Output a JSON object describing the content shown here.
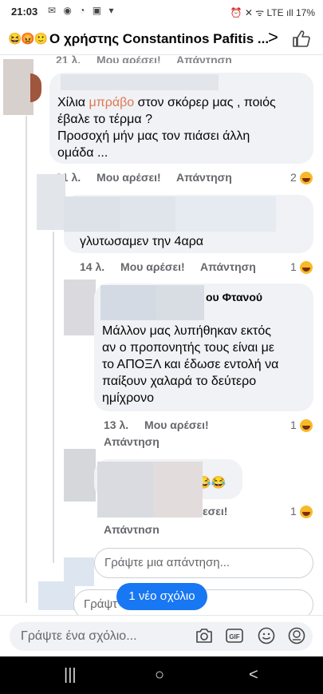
{
  "status_bar": {
    "time": "21:03",
    "left_icons": "✉ ◉ ◔ ▣ ▾",
    "right_text": "⏰ ✕ ᯤ LTE ıll 17%"
  },
  "header": {
    "reactions": "😆😡🙂",
    "title": "Ο χρήστης Constantinos Pafitis ...",
    "back_label": ">"
  },
  "top_partial_meta": {
    "time": "21 λ.",
    "like": "Μου αρέσει!",
    "reply": "Απάντηση"
  },
  "comment_1": {
    "line1_pre": "Χίλια ",
    "line1_highlight": "μπράβο",
    "line1_post": " στον σκόρερ μας , ποιός",
    "line2": "έβαλε το τέρμα ?",
    "line3": "Προσοχή μήν μας τον πιάσει άλλη",
    "line4": "ομάδα ...",
    "time": "21 λ.",
    "like": "Μου αρέσει!",
    "reply": "Απάντηση",
    "reaction_count": "2",
    "highlight_color": "#e0774e"
  },
  "comment_2": {
    "text": "γλυτωσαμεν την 4αρα",
    "time": "14 λ.",
    "like": "Μου αρέσει!",
    "reply": "Απάντηση",
    "reaction_count": "1"
  },
  "comment_3": {
    "author_suffix": "ου Φτανού",
    "line1": "Μάλλον μας λυπήθηκαν εκτός",
    "line2": "αν ο προπονητής τους είναι με",
    "line3": "το ΑΠΟΞΛ και έδωσε εντολή να",
    "line4": "παίξουν χαλαρά το δεύτερο",
    "line5": "ημίχρονο",
    "time": "13 λ.",
    "like": "Μου αρέσει!",
    "reply": "Απάντηση",
    "reaction_count": "1"
  },
  "comment_4": {
    "emoji": "😂😂",
    "like_partial": "εσει!",
    "reply": "Απάντηση",
    "reaction_count": "1"
  },
  "reply_box": {
    "placeholder": "Γράψτε μια απάντηση..."
  },
  "reply_box_2": {
    "placeholder": "Γράψτ"
  },
  "new_comments_pill": "1 νέο σχόλιο",
  "composer": {
    "placeholder": "Γράψτε ένα σχόλιο..."
  },
  "navbar": {
    "recent": "|||",
    "home": "○",
    "back": "<"
  }
}
